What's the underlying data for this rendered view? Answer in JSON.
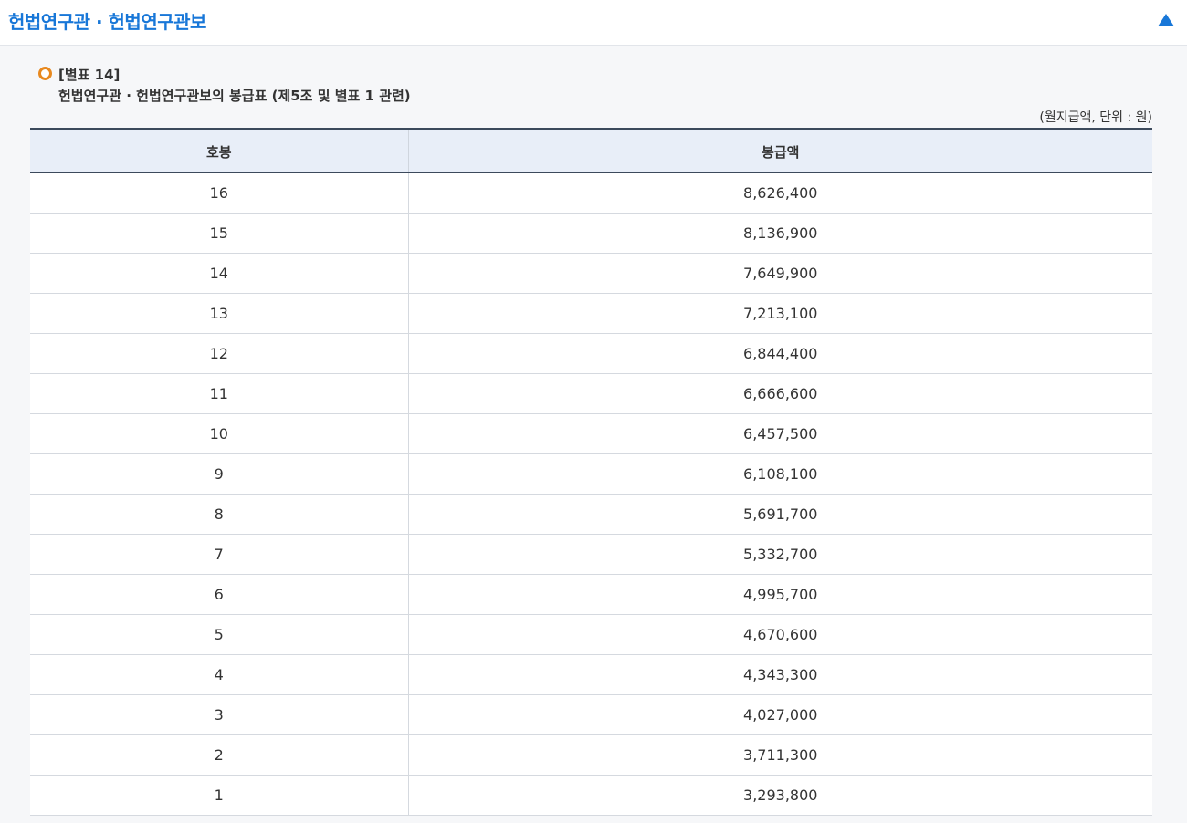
{
  "header": {
    "title": "헌법연구관 · 헌법연구관보",
    "collapse_icon": "triangle-up-icon",
    "accent_color": "#1877d8"
  },
  "caption": {
    "label": "[별표 14]",
    "title": "헌법연구관 · 헌법연구관보의 봉급표 (제5조 및 별표 1 관련)",
    "bullet_color": "#e8891f"
  },
  "unit_note": "(월지급액, 단위 : 원)",
  "table": {
    "columns": [
      "호봉",
      "봉급액"
    ],
    "rows": [
      {
        "grade": "16",
        "amount": "8,626,400"
      },
      {
        "grade": "15",
        "amount": "8,136,900"
      },
      {
        "grade": "14",
        "amount": "7,649,900"
      },
      {
        "grade": "13",
        "amount": "7,213,100"
      },
      {
        "grade": "12",
        "amount": "6,844,400"
      },
      {
        "grade": "11",
        "amount": "6,666,600"
      },
      {
        "grade": "10",
        "amount": "6,457,500"
      },
      {
        "grade": "9",
        "amount": "6,108,100"
      },
      {
        "grade": "8",
        "amount": "5,691,700"
      },
      {
        "grade": "7",
        "amount": "5,332,700"
      },
      {
        "grade": "6",
        "amount": "4,995,700"
      },
      {
        "grade": "5",
        "amount": "4,670,600"
      },
      {
        "grade": "4",
        "amount": "4,343,300"
      },
      {
        "grade": "3",
        "amount": "4,027,000"
      },
      {
        "grade": "2",
        "amount": "3,711,300"
      },
      {
        "grade": "1",
        "amount": "3,293,800"
      }
    ]
  }
}
